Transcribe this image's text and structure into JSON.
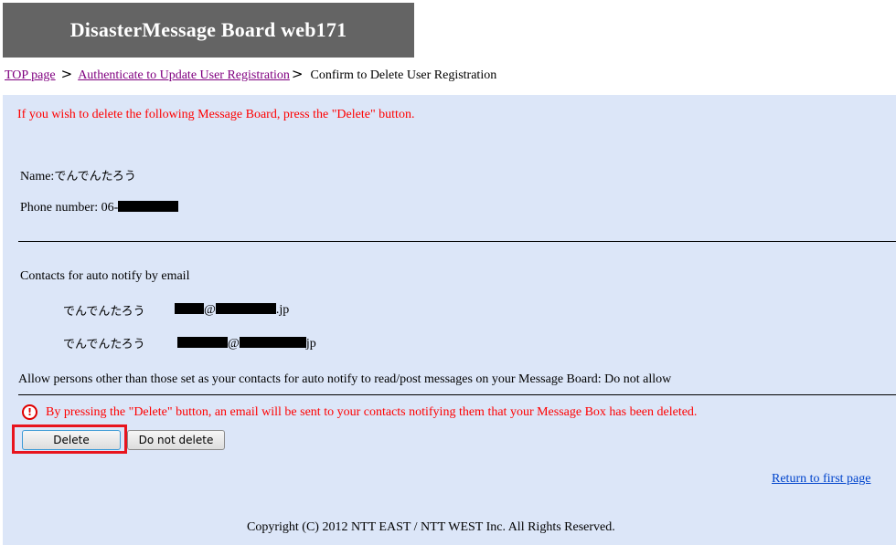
{
  "header": {
    "title": "DisasterMessage Board web171"
  },
  "breadcrumb": {
    "items": [
      {
        "label": "TOP page",
        "link": true
      },
      {
        "label": "Authenticate to Update User Registration",
        "link": true
      },
      {
        "label": "Confirm to Delete User Registration",
        "link": false
      }
    ],
    "separator": ">"
  },
  "main": {
    "instruction": "If you wish to delete the following Message Board, press the \"Delete\" button.",
    "name_label": "Name:",
    "name_value": "でんでんたろう",
    "phone_label": "Phone number:",
    "phone_value_visible": "06-",
    "contacts_heading": "Contacts for auto notify by email",
    "contacts": [
      {
        "name": "でんでんたろう",
        "email_visible_domain_suffix": ".jp",
        "at": "@"
      },
      {
        "name": "でんでんたろう",
        "email_visible_domain_suffix": "jp",
        "at": "@"
      }
    ],
    "allow_others": "Allow persons other than those set as your contacts for auto notify to read/post messages on your Message Board: Do not allow",
    "warning": "By pressing the \"Delete\" button, an email will be sent to your contacts notifying them that your Message Box has been deleted.",
    "warning_icon": "exclamation-circle-icon",
    "buttons": {
      "delete": "Delete",
      "do_not_delete": "Do not delete"
    },
    "return_link": "Return to first page"
  },
  "footer": {
    "copyright": "Copyright (C) 2012 NTT EAST / NTT WEST Inc. All Rights Reserved."
  },
  "colors": {
    "alert": "#ff0000",
    "highlight": "#e8141e",
    "content_bg": "#dce6f8",
    "header_bg": "#646464"
  }
}
